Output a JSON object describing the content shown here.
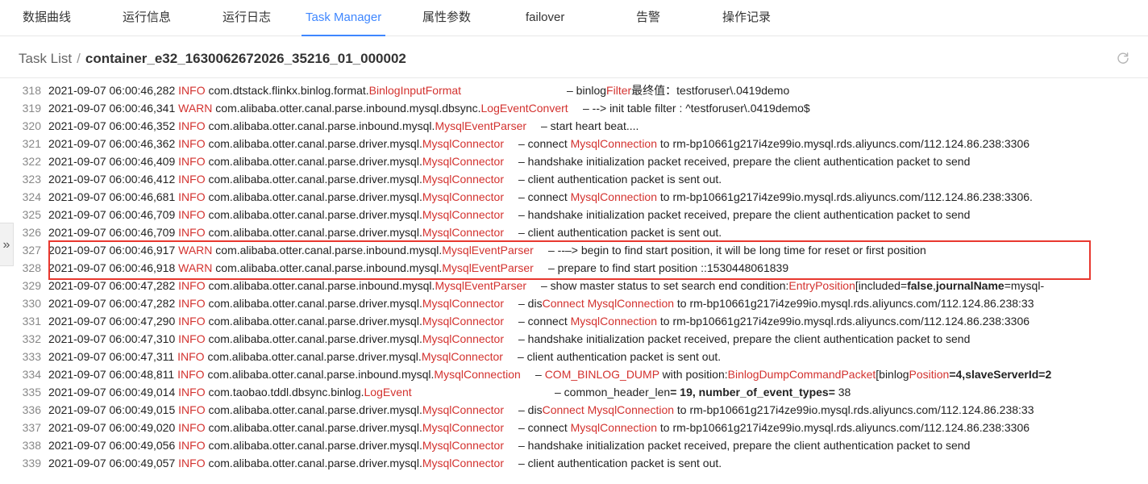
{
  "tabs": [
    {
      "label": "数据曲线",
      "active": false
    },
    {
      "label": "运行信息",
      "active": false
    },
    {
      "label": "运行日志",
      "active": false
    },
    {
      "label": "Task Manager",
      "active": true
    },
    {
      "label": "属性参数",
      "active": false
    },
    {
      "label": "failover",
      "active": false
    },
    {
      "label": "告警",
      "active": false
    },
    {
      "label": "操作记录",
      "active": false
    }
  ],
  "breadcrumb": {
    "root": "Task List",
    "separator": "/",
    "current": "container_e32_1630062672026_35216_01_000002"
  },
  "icons": {
    "refresh": "refresh-icon",
    "collapse": "double-chevron-right-icon"
  },
  "collapse_glyph": "»",
  "colors": {
    "accent": "#3f87ff",
    "log_highlight": "#d3322f",
    "selection_box": "#e8382f"
  },
  "highlighted_lines": [
    327,
    328
  ],
  "log": [
    {
      "ln": "318",
      "ts": "2021-09-07 06:00:46,282",
      "level": "INFO",
      "pkg": "com.dtstack.flinkx.binlog.format.",
      "cls": "BinlogInputFormat",
      "msg": [
        {
          "t": "– binlog"
        },
        {
          "t": "Filter",
          "red": true
        },
        {
          "t": "最终值：testforuser\\.0419demo"
        }
      ]
    },
    {
      "ln": "319",
      "ts": "2021-09-07 06:00:46,341",
      "level": "WARN",
      "pkg": "com.alibaba.otter.canal.parse.inbound.mysql.dbsync.",
      "cls": "LogEventConvert",
      "msg": [
        {
          "t": "– --> init table filter : ^testforuser\\.0419demo$"
        }
      ]
    },
    {
      "ln": "320",
      "ts": "2021-09-07 06:00:46,352",
      "level": "INFO",
      "pkg": "com.alibaba.otter.canal.parse.inbound.mysql.",
      "cls": "MysqlEventParser",
      "msg": [
        {
          "t": "– start heart beat...."
        }
      ]
    },
    {
      "ln": "321",
      "ts": "2021-09-07 06:00:46,362",
      "level": "INFO",
      "pkg": "com.alibaba.otter.canal.parse.driver.mysql.",
      "cls": "MysqlConnector",
      "msg": [
        {
          "t": "– connect "
        },
        {
          "t": "MysqlConnection",
          "red": true
        },
        {
          "t": " to rm-bp10661g217i4ze99io.mysql.rds.aliyuncs.com/112.124.86.238:3306"
        }
      ]
    },
    {
      "ln": "322",
      "ts": "2021-09-07 06:00:46,409",
      "level": "INFO",
      "pkg": "com.alibaba.otter.canal.parse.driver.mysql.",
      "cls": "MysqlConnector",
      "msg": [
        {
          "t": "– handshake initialization packet received, prepare the client authentication packet to send"
        }
      ]
    },
    {
      "ln": "323",
      "ts": "2021-09-07 06:00:46,412",
      "level": "INFO",
      "pkg": "com.alibaba.otter.canal.parse.driver.mysql.",
      "cls": "MysqlConnector",
      "msg": [
        {
          "t": "– client authentication packet is sent out."
        }
      ]
    },
    {
      "ln": "324",
      "ts": "2021-09-07 06:00:46,681",
      "level": "INFO",
      "pkg": "com.alibaba.otter.canal.parse.driver.mysql.",
      "cls": "MysqlConnector",
      "msg": [
        {
          "t": "– connect "
        },
        {
          "t": "MysqlConnection",
          "red": true
        },
        {
          "t": " to rm-bp10661g217i4ze99io.mysql.rds.aliyuncs.com/112.124.86.238:3306."
        }
      ]
    },
    {
      "ln": "325",
      "ts": "2021-09-07 06:00:46,709",
      "level": "INFO",
      "pkg": "com.alibaba.otter.canal.parse.driver.mysql.",
      "cls": "MysqlConnector",
      "msg": [
        {
          "t": "– handshake initialization packet received, prepare the client authentication packet to send"
        }
      ]
    },
    {
      "ln": "326",
      "ts": "2021-09-07 06:00:46,709",
      "level": "INFO",
      "pkg": "com.alibaba.otter.canal.parse.driver.mysql.",
      "cls": "MysqlConnector",
      "msg": [
        {
          "t": "– client authentication packet is sent out."
        }
      ]
    },
    {
      "ln": "327",
      "ts": "2021-09-07 06:00:46,917",
      "level": "WARN",
      "pkg": "com.alibaba.otter.canal.parse.inbound.mysql.",
      "cls": "MysqlEventParser",
      "msg": [
        {
          "t": "– --–> begin to find start position, it will be long time for reset or first position"
        }
      ]
    },
    {
      "ln": "328",
      "ts": "2021-09-07 06:00:46,918",
      "level": "WARN",
      "pkg": "com.alibaba.otter.canal.parse.inbound.mysql.",
      "cls": "MysqlEventParser",
      "msg": [
        {
          "t": "– prepare to find start position ::1530448061839"
        }
      ]
    },
    {
      "ln": "329",
      "ts": "2021-09-07 06:00:47,282",
      "level": "INFO",
      "pkg": "com.alibaba.otter.canal.parse.inbound.mysql.",
      "cls": "MysqlEventParser",
      "msg": [
        {
          "t": "– show master status to set search end condition:"
        },
        {
          "t": "EntryPosition",
          "red": true
        },
        {
          "t": "[included="
        },
        {
          "t": "false",
          "bold": true
        },
        {
          "t": ","
        },
        {
          "t": "journalName",
          "bold": true
        },
        {
          "t": "=mysql-"
        }
      ]
    },
    {
      "ln": "330",
      "ts": "2021-09-07 06:00:47,282",
      "level": "INFO",
      "pkg": "com.alibaba.otter.canal.parse.driver.mysql.",
      "cls": "MysqlConnector",
      "msg": [
        {
          "t": "– dis"
        },
        {
          "t": "Connect",
          "red": true
        },
        {
          "t": " "
        },
        {
          "t": "MysqlConnection",
          "red": true
        },
        {
          "t": " to rm-bp10661g217i4ze99io.mysql.rds.aliyuncs.com/112.124.86.238:33"
        }
      ]
    },
    {
      "ln": "331",
      "ts": "2021-09-07 06:00:47,290",
      "level": "INFO",
      "pkg": "com.alibaba.otter.canal.parse.driver.mysql.",
      "cls": "MysqlConnector",
      "msg": [
        {
          "t": "– connect "
        },
        {
          "t": "MysqlConnection",
          "red": true
        },
        {
          "t": " to rm-bp10661g217i4ze99io.mysql.rds.aliyuncs.com/112.124.86.238:3306"
        }
      ]
    },
    {
      "ln": "332",
      "ts": "2021-09-07 06:00:47,310",
      "level": "INFO",
      "pkg": "com.alibaba.otter.canal.parse.driver.mysql.",
      "cls": "MysqlConnector",
      "msg": [
        {
          "t": "– handshake initialization packet received, prepare the client authentication packet to send"
        }
      ]
    },
    {
      "ln": "333",
      "ts": "2021-09-07 06:00:47,311",
      "level": "INFO",
      "pkg": "com.alibaba.otter.canal.parse.driver.mysql.",
      "cls": "MysqlConnector",
      "msg": [
        {
          "t": "– client authentication packet is sent out."
        }
      ]
    },
    {
      "ln": "334",
      "ts": "2021-09-07 06:00:48,811",
      "level": "INFO",
      "pkg": "com.alibaba.otter.canal.parse.inbound.mysql.",
      "cls": "MysqlConnection",
      "msg": [
        {
          "t": "– "
        },
        {
          "t": "COM_BINLOG_DUMP",
          "red": true
        },
        {
          "t": " with position:"
        },
        {
          "t": "BinlogDumpCommandPacket",
          "red": true
        },
        {
          "t": "[binlog"
        },
        {
          "t": "Position",
          "red": true
        },
        {
          "t": "=4,slaveServerId=2",
          "bold": true
        }
      ]
    },
    {
      "ln": "335",
      "ts": "2021-09-07 06:00:49,014",
      "level": "INFO",
      "pkg": "com.taobao.tddl.dbsync.binlog.",
      "cls": "LogEvent",
      "msg": [
        {
          "t": "– common_header_len"
        },
        {
          "t": "= 19, number_of_event_types=",
          "bold": true
        },
        {
          "t": " 38"
        }
      ]
    },
    {
      "ln": "336",
      "ts": "2021-09-07 06:00:49,015",
      "level": "INFO",
      "pkg": "com.alibaba.otter.canal.parse.driver.mysql.",
      "cls": "MysqlConnector",
      "msg": [
        {
          "t": "– dis"
        },
        {
          "t": "Connect",
          "red": true
        },
        {
          "t": " "
        },
        {
          "t": "MysqlConnection",
          "red": true
        },
        {
          "t": " to rm-bp10661g217i4ze99io.mysql.rds.aliyuncs.com/112.124.86.238:33"
        }
      ]
    },
    {
      "ln": "337",
      "ts": "2021-09-07 06:00:49,020",
      "level": "INFO",
      "pkg": "com.alibaba.otter.canal.parse.driver.mysql.",
      "cls": "MysqlConnector",
      "msg": [
        {
          "t": "– connect "
        },
        {
          "t": "MysqlConnection",
          "red": true
        },
        {
          "t": " to rm-bp10661g217i4ze99io.mysql.rds.aliyuncs.com/112.124.86.238:3306"
        }
      ]
    },
    {
      "ln": "338",
      "ts": "2021-09-07 06:00:49,056",
      "level": "INFO",
      "pkg": "com.alibaba.otter.canal.parse.driver.mysql.",
      "cls": "MysqlConnector",
      "msg": [
        {
          "t": "– handshake initialization packet received, prepare the client authentication packet to send"
        }
      ]
    },
    {
      "ln": "339",
      "ts": "2021-09-07 06:00:49,057",
      "level": "INFO",
      "pkg": "com.alibaba.otter.canal.parse.driver.mysql.",
      "cls": "MysqlConnector",
      "msg": [
        {
          "t": "– client authentication packet is sent out."
        }
      ]
    }
  ]
}
